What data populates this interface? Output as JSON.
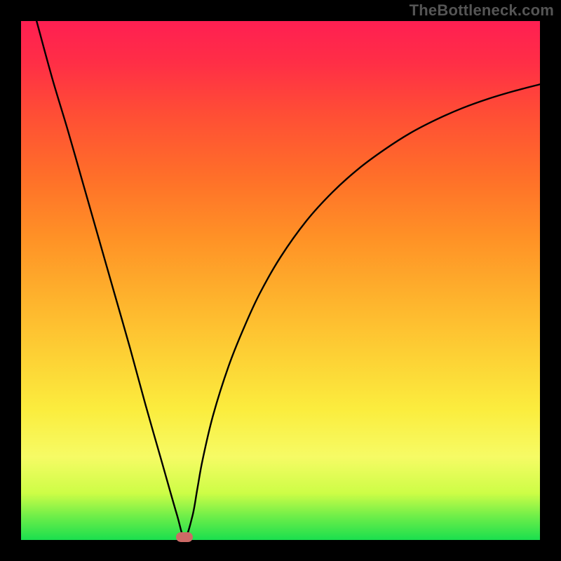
{
  "watermark": "TheBottleneck.com",
  "chart_data": {
    "type": "line",
    "title": "",
    "xlabel": "",
    "ylabel": "",
    "xlim": [
      0,
      100
    ],
    "ylim": [
      0,
      100
    ],
    "grid": false,
    "series": [
      {
        "name": "curve",
        "x": [
          3,
          6,
          9,
          12,
          15,
          18,
          21,
          24,
          27,
          30,
          31.5,
          33,
          34,
          35,
          37,
          40,
          43,
          46,
          50,
          55,
          60,
          65,
          70,
          75,
          80,
          85,
          90,
          95,
          100
        ],
        "y": [
          100,
          89,
          79,
          68.5,
          58,
          47.5,
          37,
          26,
          15.5,
          5,
          0.5,
          4.5,
          10,
          15.5,
          24,
          33.5,
          41,
          47.5,
          54.5,
          61.5,
          67,
          71.5,
          75.2,
          78.4,
          81,
          83.2,
          85,
          86.5,
          87.8
        ]
      }
    ],
    "marker": {
      "x": 31.5,
      "y": 0.6
    },
    "background_gradient": {
      "stops": [
        {
          "pos": 0.0,
          "color": "#1adf4e"
        },
        {
          "pos": 0.045,
          "color": "#6dee49"
        },
        {
          "pos": 0.09,
          "color": "#cdfd46"
        },
        {
          "pos": 0.16,
          "color": "#f6fb65"
        },
        {
          "pos": 0.25,
          "color": "#fbed3e"
        },
        {
          "pos": 0.35,
          "color": "#fdd235"
        },
        {
          "pos": 0.46,
          "color": "#feb42d"
        },
        {
          "pos": 0.58,
          "color": "#ff9226"
        },
        {
          "pos": 0.7,
          "color": "#ff6f29"
        },
        {
          "pos": 0.82,
          "color": "#ff4e35"
        },
        {
          "pos": 0.92,
          "color": "#ff2e46"
        },
        {
          "pos": 1.0,
          "color": "#ff1f52"
        }
      ]
    }
  }
}
